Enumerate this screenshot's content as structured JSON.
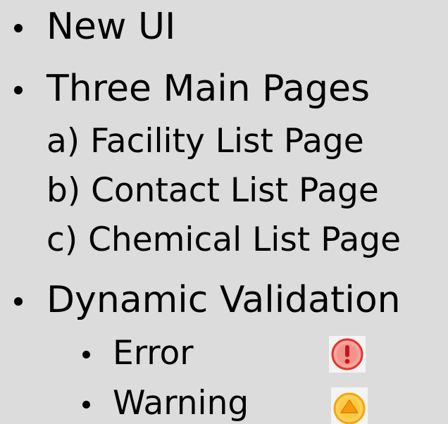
{
  "bullets": [
    {
      "text": "New UI"
    },
    {
      "text": "Three Main Pages",
      "subitems": [
        "a) Facility List Page",
        "b) Contact List Page",
        "c) Chemical List Page"
      ]
    },
    {
      "text": "Dynamic Validation",
      "subitems": [
        {
          "text": "Error",
          "icon": "error-icon",
          "color": "#e8332a"
        },
        {
          "text": "Warning",
          "icon": "warning-icon",
          "color": "#f5a60a"
        }
      ]
    }
  ]
}
